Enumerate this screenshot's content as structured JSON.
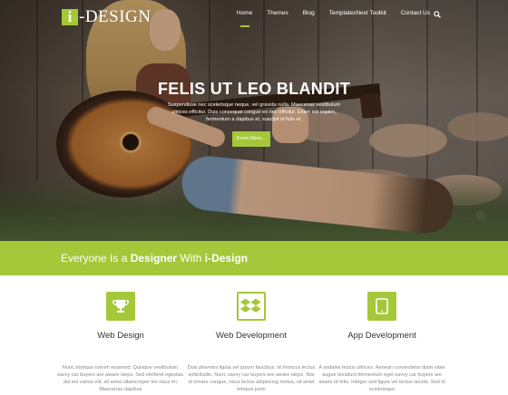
{
  "header": {
    "logo_mark": "i",
    "logo_text": "-DESIGN",
    "nav": [
      {
        "label": "Home",
        "active": true
      },
      {
        "label": "Themes",
        "active": false
      },
      {
        "label": "Blog",
        "active": false
      },
      {
        "label": "TemplatesNext Toolkit",
        "active": false
      },
      {
        "label": "Contact Us",
        "active": false
      }
    ],
    "search_icon": "search-icon"
  },
  "hero": {
    "title": "FELIS UT LEO BLANDIT",
    "text": "Suspendisse nec scelerisque neque, vel gravida nulla. Maecenas vestibulum ultrices efficitur. Duis consequat congue ex nec efficitur. Etiam est sapien, fermentum a dapibus et, suscipit id felis et.",
    "button_label": "Know More..."
  },
  "banner": {
    "text_plain": "Everyone Is a ",
    "text_bold1": "Designer",
    "text_mid": " With ",
    "text_bold2": "i-Design"
  },
  "services": [
    {
      "icon": "trophy-icon",
      "title": "Web Design",
      "text": "Nunc tristique rutrum euismod. Quisque vestibulum, savvy car buyers are aware steps. Sed eleifend egestas. dui est varius elit, sit amet ullamcorper leo risus mi. Maecenas dapibus"
    },
    {
      "icon": "dropbox-icon",
      "title": "Web Development",
      "text": "Duis pharetra ligula vel ipsum faucibus, id rhoncus lectus sollicitudin. Nunc savvy car buyers are aware steps. Nisi id ornare congue, risus lectus adipiscing metus, sit amet tempus justo"
    },
    {
      "icon": "tablet-icon",
      "title": "App Development",
      "text": "A sodales lectus ultrices. Aenean consectetur diam vitae augue tincidunt fermentum eget savvy car buyers are aware id felis. Integer sed ligula vel lectus iaculis. Sed id scelerisque"
    }
  ],
  "colors": {
    "accent": "#a5c83a",
    "text_dark": "#333333",
    "text_muted": "#888888"
  }
}
